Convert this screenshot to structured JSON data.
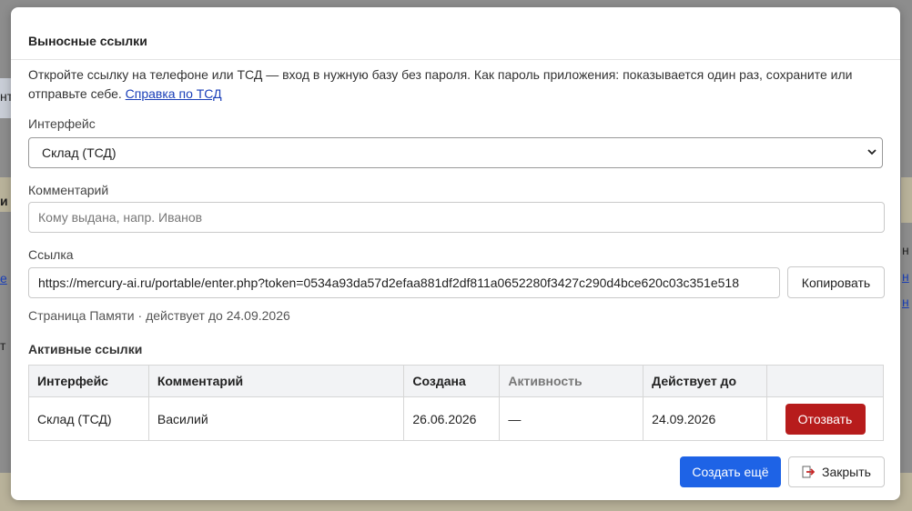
{
  "background": {
    "left_fragments": [
      "нт",
      "и",
      "е",
      "т"
    ],
    "right_fragments": [
      "н",
      "н",
      "н"
    ]
  },
  "modal": {
    "title": "Выносные ссылки",
    "description": "Откройте ссылку на телефоне или ТСД — вход в нужную базу без пароля. Как пароль приложения: показывается один раз, сохраните или отправьте себе.",
    "help_link": "Справка по ТСД",
    "interface_label": "Интерфейс",
    "interface_value": "Склад (ТСД)",
    "comment_label": "Комментарий",
    "comment_value": "",
    "comment_placeholder": "Кому выдана, напр. Иванов",
    "link_label": "Ссылка",
    "link_value": "https://mercury-ai.ru/portable/enter.php?token=0534a93da57d2efaa881df2df811a0652280f3427c290d4bce620c03c351e518",
    "copy_label": "Копировать",
    "validity_info": "Страница Памяти · действует до 24.09.2026",
    "active_links_title": "Активные ссылки",
    "table": {
      "headers": [
        "Интерфейс",
        "Комментарий",
        "Создана",
        "Активность",
        "Действует до",
        ""
      ],
      "rows": [
        {
          "interface": "Склад (ТСД)",
          "comment": "Василий",
          "created": "26.06.2026",
          "activity": "—",
          "valid_until": "24.09.2026",
          "action": "Отозвать"
        }
      ]
    },
    "create_label": "Создать ещё",
    "close_label": "Закрыть"
  },
  "colors": {
    "primary": "#1e63e6",
    "danger": "#b71c1c",
    "link": "#1a3fb8"
  },
  "icons": {
    "close": "exit-door-icon",
    "select": "chevron-down-icon"
  }
}
